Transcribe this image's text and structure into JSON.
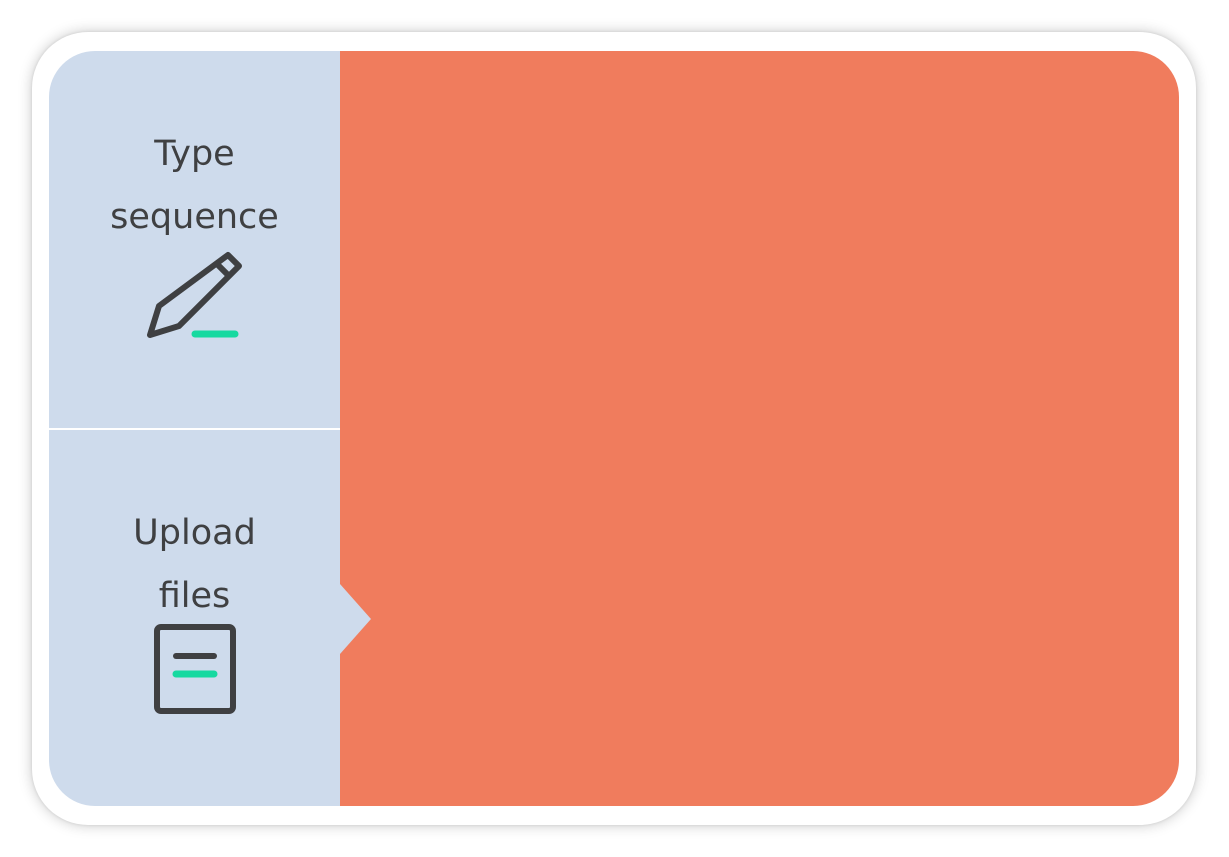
{
  "sidebar": {
    "tabs": [
      {
        "label_line1": "Type",
        "label_line2": "sequence",
        "icon": "pencil-icon"
      },
      {
        "label_line1": "Upload",
        "label_line2": "files",
        "icon": "document-icon"
      }
    ],
    "selected_tab": "Upload files"
  },
  "colors": {
    "sidebar_bg": "#cedbec",
    "main_bg": "#f07c5d",
    "icon_stroke": "#3f4042",
    "accent": "#16d9a0"
  }
}
